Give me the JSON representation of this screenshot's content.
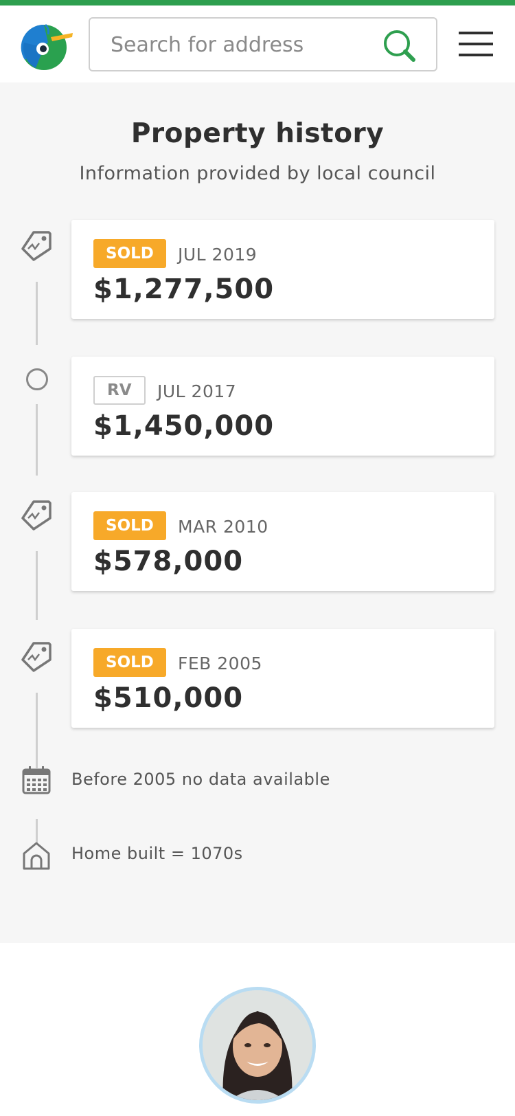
{
  "header": {
    "search_placeholder": "Search for address"
  },
  "history": {
    "title": "Property history",
    "subtitle": "Information provided by local council",
    "events": [
      {
        "badge": "SOLD",
        "badge_type": "sold",
        "date": "JUL 2019",
        "price": "$1,277,500",
        "icon": "price-tag-icon"
      },
      {
        "badge": "RV",
        "badge_type": "rv",
        "date": "JUL 2017",
        "price": "$1,450,000",
        "icon": "circle-marker-icon"
      },
      {
        "badge": "SOLD",
        "badge_type": "sold",
        "date": "MAR 2010",
        "price": "$578,000",
        "icon": "price-tag-icon"
      },
      {
        "badge": "SOLD",
        "badge_type": "sold",
        "date": "FEB 2005",
        "price": "$510,000",
        "icon": "price-tag-icon"
      }
    ],
    "notes": [
      {
        "text": "Before 2005 no data available",
        "icon": "calendar-icon"
      },
      {
        "text": "Home built = 1070s",
        "icon": "house-icon"
      }
    ]
  },
  "colors": {
    "brand_green": "#2e9f4f",
    "sold_badge": "#f7a929",
    "background": "#f6f6f6"
  }
}
